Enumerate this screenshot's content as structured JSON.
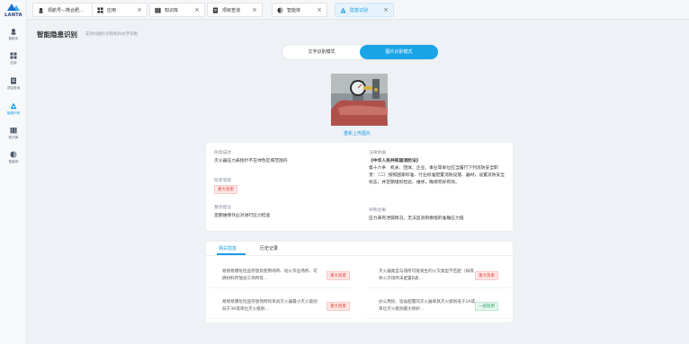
{
  "brand": {
    "logo_text": "LANTA"
  },
  "sidebar": {
    "items": [
      {
        "label": "新助手",
        "icon": "assistant-icon"
      },
      {
        "label": "应用",
        "icon": "apps-icon"
      },
      {
        "label": "项目查询",
        "icon": "project-icon"
      },
      {
        "label": "隐患识别",
        "icon": "hazard-icon",
        "active": true
      },
      {
        "label": "知识库",
        "icon": "knowledge-icon"
      },
      {
        "label": "智能体",
        "icon": "agent-icon"
      }
    ]
  },
  "tabs": [
    {
      "label": "领航号—熊合肥...",
      "icon": "assistant-icon"
    },
    {
      "label": "应用",
      "icon": "apps-icon"
    },
    {
      "label": "知识库",
      "icon": "knowledge-icon"
    },
    {
      "label": "项目查询",
      "icon": "project-icon"
    },
    {
      "label": "智能体",
      "icon": "agent-icon"
    },
    {
      "label": "隐患识别",
      "icon": "hazard-icon",
      "active": true
    }
  ],
  "page": {
    "title": "智能隐患识别",
    "subtitle": "支持AI图片识别和AI文字识别"
  },
  "mode": {
    "text_label": "文字识别模式",
    "image_label": "图片识别模式",
    "selected": "image"
  },
  "photo": {
    "reupload_label": "重新上传图片"
  },
  "detail": {
    "desc_label": "隐患描述",
    "desc_value": "灭火器压力表指针不在绿色区域范围内",
    "level_label": "隐患等级",
    "level_value": "重大隐患",
    "fix_label": "整改建议",
    "fix_value": "定期维保作业对进行压力检查",
    "law_label": "法律依据",
    "law_title": "《中华人民共和国消防法》",
    "law_value": "第十六条　机关、团体、企业、事业等单位应当履行下列消防安全职责：（二）按照国家标准、行业标准配置消防设施、器材，设置消防安全标志，并定期组织检验、维修，确保完好有效。",
    "consequence_label": "导致后果",
    "consequence_value": "压力表有泄漏情况，无法监测到模组的准确压力值"
  },
  "related": {
    "tab_related": "相关隐患",
    "tab_history": "历史记录",
    "items": [
      {
        "text": "易燃易爆危险品存放及使用场所、动火作业场所、可燃材料存放加工场所等...",
        "level": "重大隐患",
        "kind": "danger"
      },
      {
        "text": "灭火器类型与场所可能发生的火灾类型不匹配（如液体火灾场所未配置B类...",
        "level": "重大隐患",
        "kind": "danger"
      },
      {
        "text": "易燃易爆危险品存放场所的单具灭火器最小灭火级别低于3A或单位灭火级别...",
        "level": "重大隐患",
        "kind": "danger"
      },
      {
        "text": "办公用房、宿舍配置的灭火器单具灭火级别低于1A或单位灭火级别最大保护...",
        "level": "一般隐患",
        "kind": "normal"
      }
    ]
  },
  "colors": {
    "accent": "#1aa4e8",
    "danger": "#e04a3f",
    "normal": "#2fa86b"
  }
}
